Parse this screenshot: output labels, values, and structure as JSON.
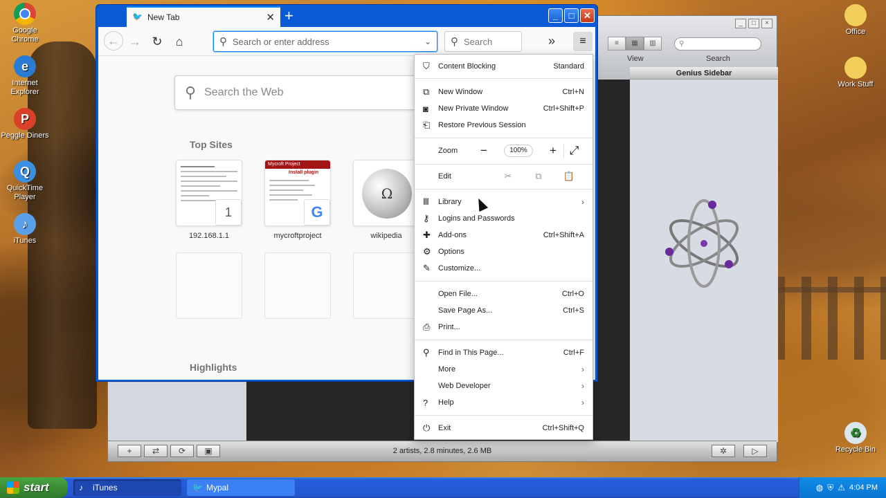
{
  "desktop": {
    "left_icons": [
      {
        "label": "Google Chrome",
        "icon": "chrome-icon"
      },
      {
        "label": "Internet Explorer",
        "icon": "ie-icon"
      },
      {
        "label": "Peggle Diners",
        "icon": "peggle-icon"
      },
      {
        "label": "QuickTime Player",
        "icon": "quicktime-icon"
      },
      {
        "label": "iTunes",
        "icon": "itunes-icon"
      }
    ],
    "right_icons": [
      {
        "label": "Office",
        "icon": "folder-icon"
      },
      {
        "label": "Work Stuff",
        "icon": "folder-icon"
      },
      {
        "label": "Recycle Bin",
        "icon": "recycle-bin-icon"
      }
    ]
  },
  "itunes": {
    "view_label": "View",
    "search_label": "Search",
    "genius_title": "Genius Sidebar",
    "status": "2 artists, 2.8 minutes, 2.6 MB"
  },
  "firefox": {
    "tab_title": "New Tab",
    "url_placeholder": "Search or enter address",
    "search_placeholder": "Search",
    "page_search_placeholder": "Search the Web",
    "top_sites_title": "Top Sites",
    "highlights_title": "Highlights",
    "top_sites": [
      {
        "label": "192.168.1.1",
        "badge": "1"
      },
      {
        "label": "mycroftproject",
        "badge": "G",
        "header": "Mycroft Project",
        "subheader": "Install plugin"
      },
      {
        "label": "wikipedia",
        "badge": ""
      }
    ]
  },
  "menu": {
    "content_blocking": {
      "label": "Content Blocking",
      "value": "Standard"
    },
    "new_window": {
      "label": "New Window",
      "shortcut": "Ctrl+N"
    },
    "new_private_window": {
      "label": "New Private Window",
      "shortcut": "Ctrl+Shift+P"
    },
    "restore_session": {
      "label": "Restore Previous Session"
    },
    "zoom": {
      "label": "Zoom",
      "value": "100%"
    },
    "edit": {
      "label": "Edit"
    },
    "library": {
      "label": "Library"
    },
    "logins": {
      "label": "Logins and Passwords"
    },
    "addons": {
      "label": "Add-ons",
      "shortcut": "Ctrl+Shift+A"
    },
    "options": {
      "label": "Options"
    },
    "customize": {
      "label": "Customize..."
    },
    "open_file": {
      "label": "Open File...",
      "shortcut": "Ctrl+O"
    },
    "save_page": {
      "label": "Save Page As...",
      "shortcut": "Ctrl+S"
    },
    "print": {
      "label": "Print..."
    },
    "find": {
      "label": "Find in This Page...",
      "shortcut": "Ctrl+F"
    },
    "more": {
      "label": "More"
    },
    "web_developer": {
      "label": "Web Developer"
    },
    "help": {
      "label": "Help"
    },
    "exit": {
      "label": "Exit",
      "shortcut": "Ctrl+Shift+Q"
    }
  },
  "taskbar": {
    "start_label": "start",
    "tasks": [
      {
        "label": "iTunes"
      },
      {
        "label": "Mypal"
      }
    ],
    "clock": "4:04 PM"
  }
}
